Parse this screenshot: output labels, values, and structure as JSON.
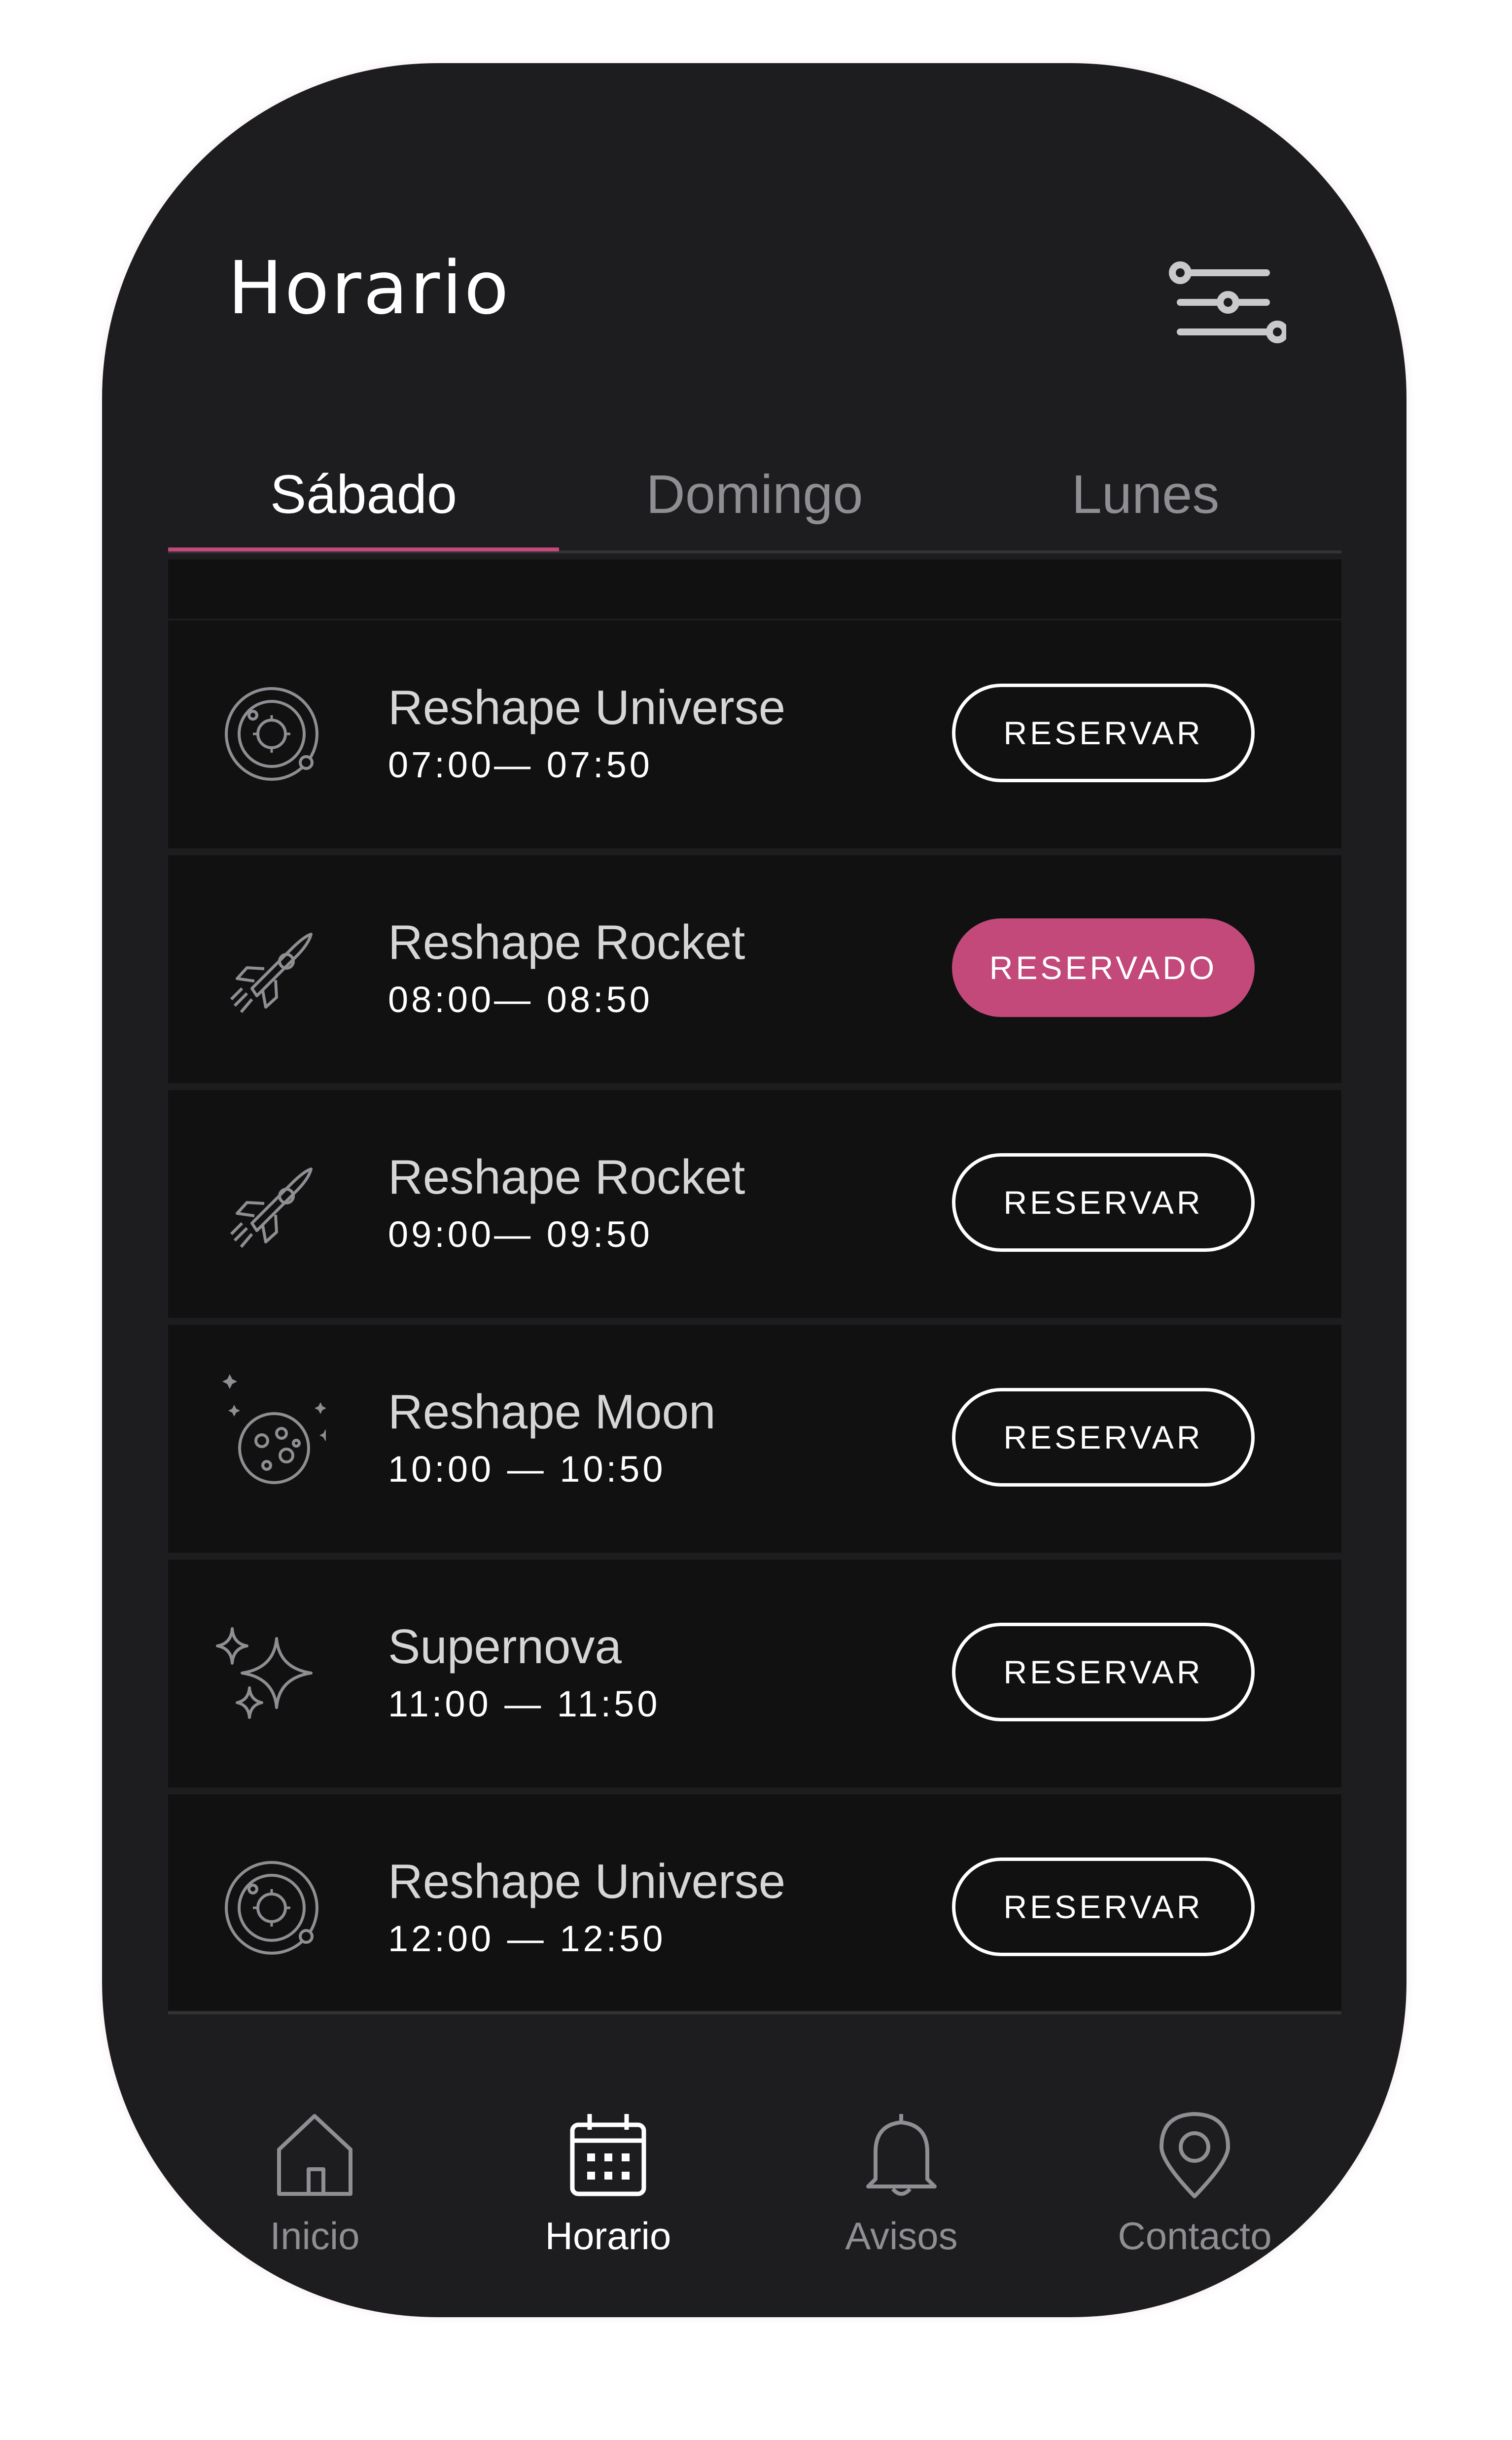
{
  "header": {
    "title": "Horario",
    "filter_icon": "sliders-icon"
  },
  "tabs": [
    {
      "label": "Sábado",
      "active": true
    },
    {
      "label": "Domingo",
      "active": false
    },
    {
      "label": "Lunes",
      "active": false
    }
  ],
  "classes": [
    {
      "name": "Reshape Universe",
      "time": "07:00— 07:50",
      "button": "RESERVAR",
      "reserved": false,
      "icon": "galaxy-icon"
    },
    {
      "name": "Reshape Rocket",
      "time": "08:00— 08:50",
      "button": "RESERVADO",
      "reserved": true,
      "icon": "rocket-icon"
    },
    {
      "name": "Reshape Rocket",
      "time": "09:00— 09:50",
      "button": "RESERVAR",
      "reserved": false,
      "icon": "rocket-icon"
    },
    {
      "name": "Reshape Moon",
      "time": "10:00 — 10:50",
      "button": "RESERVAR",
      "reserved": false,
      "icon": "moon-icon"
    },
    {
      "name": "Supernova",
      "time": "11:00  — 11:50",
      "button": "RESERVAR",
      "reserved": false,
      "icon": "sparkles-icon"
    },
    {
      "name": "Reshape Universe",
      "time": "12:00 — 12:50",
      "button": "RESERVAR",
      "reserved": false,
      "icon": "galaxy-icon"
    }
  ],
  "nav": [
    {
      "label": "Inicio",
      "icon": "home-icon",
      "active": false
    },
    {
      "label": "Horario",
      "icon": "calendar-icon",
      "active": true
    },
    {
      "label": "Avisos",
      "icon": "bell-icon",
      "active": false
    },
    {
      "label": "Contacto",
      "icon": "location-pin-icon",
      "active": false
    }
  ],
  "colors": {
    "accent": "#c2497a",
    "background": "#1d1d1f",
    "card": "#111111",
    "muted_text": "#8e8e93"
  }
}
